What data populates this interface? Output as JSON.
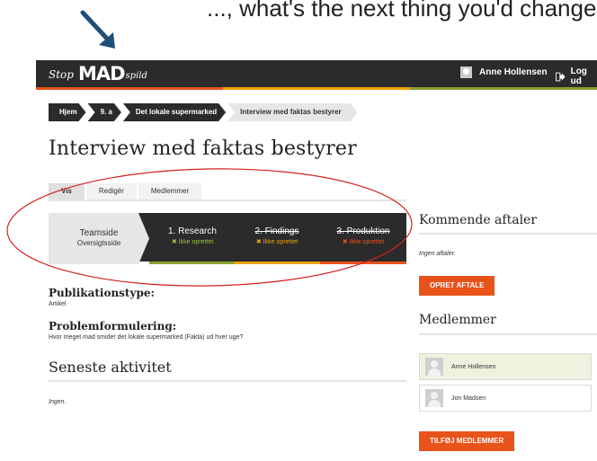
{
  "header": {
    "brand_prefix": "Stop",
    "brand_main": "MAD",
    "brand_suffix": "spild",
    "user_name": "Anne Hollensen",
    "logout_label": "Log ud",
    "stripe_colors": [
      "#e8531a",
      "#f0a500",
      "#8aa12c"
    ]
  },
  "breadcrumb": {
    "items": [
      "Hjem",
      "9. a",
      "Det lokale supermarked",
      "Interview med faktas bestyrer"
    ]
  },
  "page": {
    "title": "Interview med faktas bestyrer"
  },
  "tabs": [
    {
      "label": "Vis",
      "active": true
    },
    {
      "label": "Redigér",
      "active": false
    },
    {
      "label": "Medlemmer",
      "active": false
    }
  ],
  "stepper": {
    "teamside": {
      "title": "Teamside",
      "subtitle": "Oversigtsside"
    },
    "steps": [
      {
        "title": "1. Research",
        "status": "✖ Ikke oprettet",
        "status_color": "#9bc23c",
        "bar_color": "#8aa12c"
      },
      {
        "title": "2. Findings",
        "status": "✖ Ikke oprettet",
        "status_color": "#f0a500",
        "bar_color": "#e8a200"
      },
      {
        "title": "3. Produktion",
        "status": "✖ Ikke oprettet",
        "status_color": "#e8531a",
        "bar_color": "#e8531a"
      }
    ]
  },
  "details": {
    "pub_label": "Publikationstype:",
    "pub_value": "Artikel",
    "problem_label": "Problemformulering:",
    "problem_value": "Hvor meget mad smider det lokale supermarked (Fakta) ud hver uge?",
    "activity_title": "Seneste aktivitet",
    "activity_value": "Ingen."
  },
  "sidebar": {
    "upcoming_title": "Kommende aftaler",
    "upcoming_empty": "Ingen aftaler.",
    "create_button": "OPRET AFTALE",
    "members_title": "Medlemmer",
    "members": [
      "Anne Hollensen",
      "Jon Madsen"
    ],
    "add_members_button": "TILFØJ MEDLEMMER"
  },
  "annotation": {
    "top_text": "..., what's the next thing you'd change?"
  }
}
